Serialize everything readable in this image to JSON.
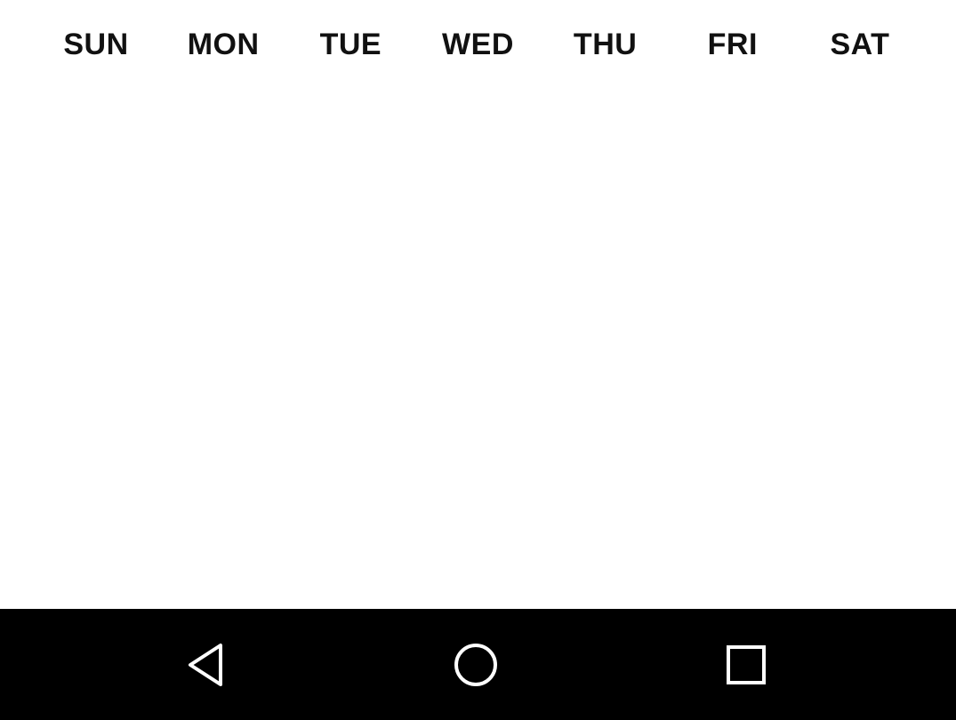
{
  "calendar": {
    "weekdays": [
      "SUN",
      "MON",
      "TUE",
      "WED",
      "THU",
      "FRI",
      "SAT"
    ]
  },
  "nav_bar": {
    "background": "#000000",
    "icon_color": "#ffffff",
    "buttons": [
      {
        "name": "back",
        "icon": "triangle-back-icon"
      },
      {
        "name": "home",
        "icon": "circle-home-icon"
      },
      {
        "name": "recents",
        "icon": "square-recents-icon"
      }
    ]
  }
}
